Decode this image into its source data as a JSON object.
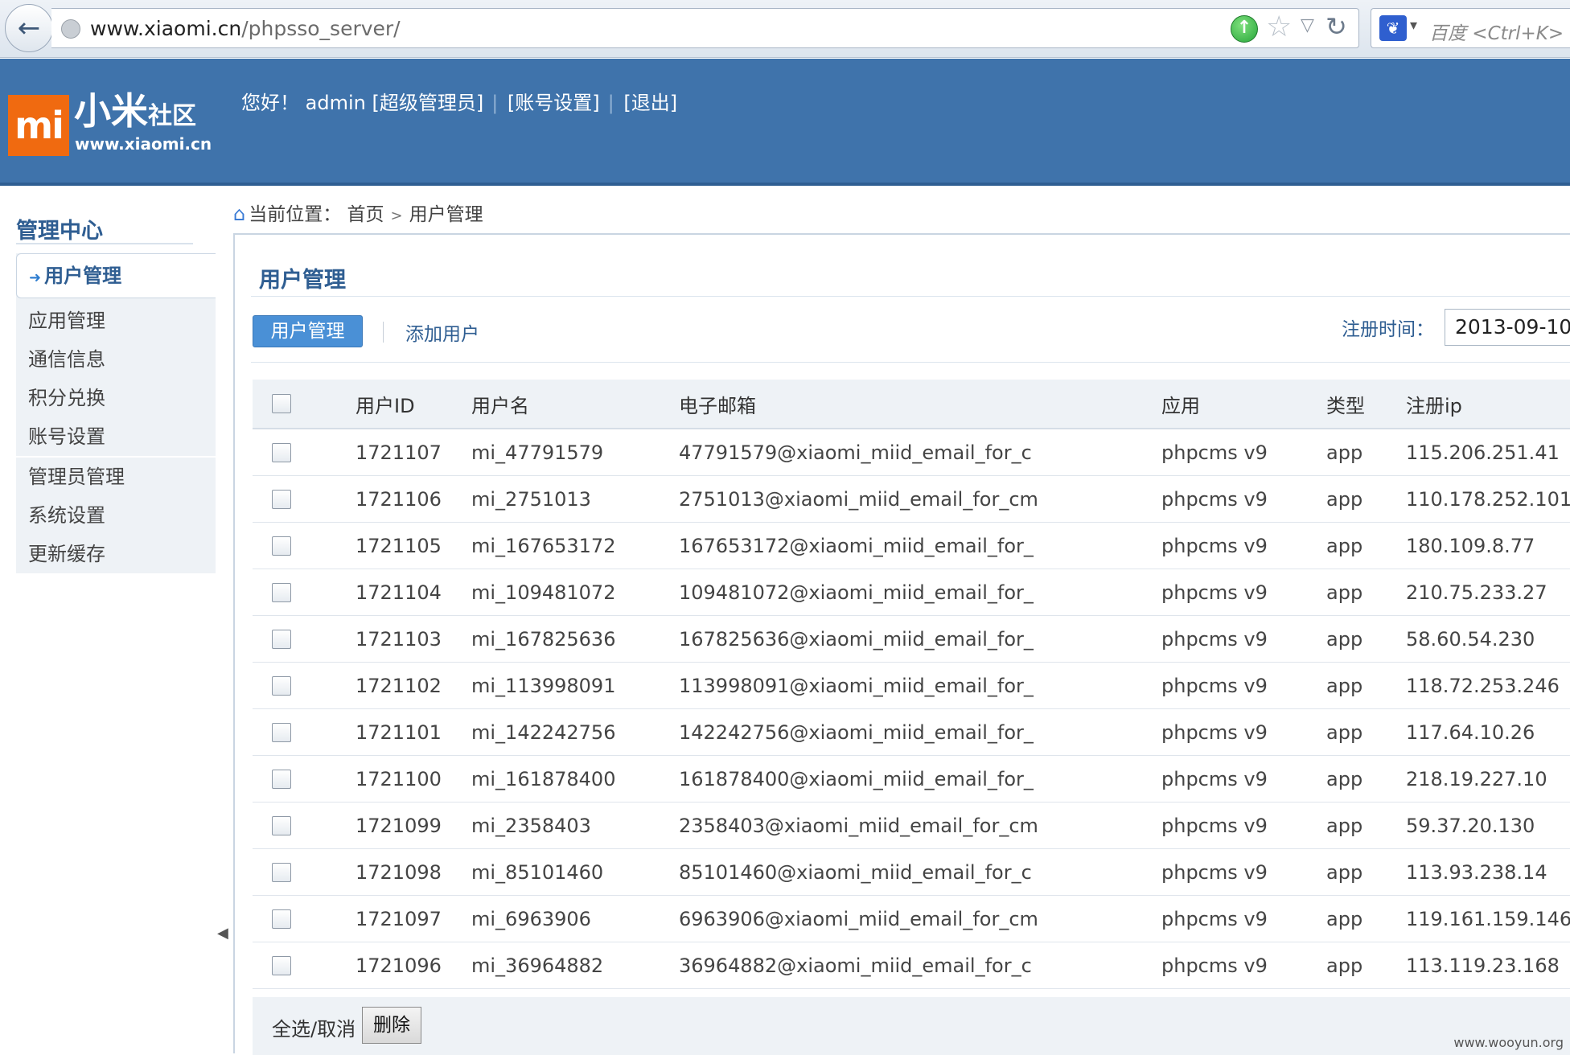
{
  "browser": {
    "url_domain": "www.xiaomi.cn",
    "url_path": "/phpsso_server/",
    "search_placeholder": "百度 <Ctrl+K>"
  },
  "header": {
    "logo_mark": "mi",
    "logo_name": "小米",
    "logo_sub": "社区",
    "logo_url": "www.xiaomi.cn",
    "greeting": "您好！ admin [超级管理员]",
    "account_link": "[账号设置]",
    "logout_link": "[退出]"
  },
  "sidebar": {
    "title": "管理中心",
    "items": [
      {
        "label": "用户管理"
      },
      {
        "label": "应用管理"
      },
      {
        "label": "通信信息"
      },
      {
        "label": "积分兑换"
      },
      {
        "label": "账号设置"
      },
      {
        "label": "管理员管理"
      },
      {
        "label": "系统设置"
      },
      {
        "label": "更新缓存"
      }
    ]
  },
  "breadcrumb": {
    "prefix": "当前位置：",
    "home": "首页",
    "current": "用户管理"
  },
  "panel": {
    "title": "用户管理",
    "tab_active": "用户管理",
    "tab_add": "添加用户",
    "reg_label": "注册时间：",
    "reg_value": "2013-09-10"
  },
  "table": {
    "headers": {
      "id": "用户ID",
      "name": "用户名",
      "email": "电子邮箱",
      "app": "应用",
      "type": "类型",
      "ip": "注册ip"
    },
    "rows": [
      {
        "id": "1721107",
        "name": "mi_47791579",
        "email": "47791579@xiaomi_miid_email_for_c",
        "app": "phpcms v9",
        "type": "app",
        "ip": "115.206.251.41"
      },
      {
        "id": "1721106",
        "name": "mi_2751013",
        "email": "2751013@xiaomi_miid_email_for_cm",
        "app": "phpcms v9",
        "type": "app",
        "ip": "110.178.252.101"
      },
      {
        "id": "1721105",
        "name": "mi_167653172",
        "email": "167653172@xiaomi_miid_email_for_",
        "app": "phpcms v9",
        "type": "app",
        "ip": "180.109.8.77"
      },
      {
        "id": "1721104",
        "name": "mi_109481072",
        "email": "109481072@xiaomi_miid_email_for_",
        "app": "phpcms v9",
        "type": "app",
        "ip": "210.75.233.27"
      },
      {
        "id": "1721103",
        "name": "mi_167825636",
        "email": "167825636@xiaomi_miid_email_for_",
        "app": "phpcms v9",
        "type": "app",
        "ip": "58.60.54.230"
      },
      {
        "id": "1721102",
        "name": "mi_113998091",
        "email": "113998091@xiaomi_miid_email_for_",
        "app": "phpcms v9",
        "type": "app",
        "ip": "118.72.253.246"
      },
      {
        "id": "1721101",
        "name": "mi_142242756",
        "email": "142242756@xiaomi_miid_email_for_",
        "app": "phpcms v9",
        "type": "app",
        "ip": "117.64.10.26"
      },
      {
        "id": "1721100",
        "name": "mi_161878400",
        "email": "161878400@xiaomi_miid_email_for_",
        "app": "phpcms v9",
        "type": "app",
        "ip": "218.19.227.10"
      },
      {
        "id": "1721099",
        "name": "mi_2358403",
        "email": "2358403@xiaomi_miid_email_for_cm",
        "app": "phpcms v9",
        "type": "app",
        "ip": "59.37.20.130"
      },
      {
        "id": "1721098",
        "name": "mi_85101460",
        "email": "85101460@xiaomi_miid_email_for_c",
        "app": "phpcms v9",
        "type": "app",
        "ip": "113.93.238.14"
      },
      {
        "id": "1721097",
        "name": "mi_6963906",
        "email": "6963906@xiaomi_miid_email_for_cm",
        "app": "phpcms v9",
        "type": "app",
        "ip": "119.161.159.146"
      },
      {
        "id": "1721096",
        "name": "mi_36964882",
        "email": "36964882@xiaomi_miid_email_for_c",
        "app": "phpcms v9",
        "type": "app",
        "ip": "113.119.23.168"
      }
    ],
    "select_all_label": "全选/取消",
    "delete_label": "删除"
  },
  "watermark": "www.wooyun.org",
  "colors": {
    "header_bg": "#3f73ab",
    "accent": "#2f5e92",
    "logo_orange": "#f06a10",
    "tab_active": "#4a90d6"
  },
  "icons": {
    "back": "back-arrow-icon",
    "home": "home-icon",
    "star": "star-icon",
    "reload": "reload-icon"
  }
}
